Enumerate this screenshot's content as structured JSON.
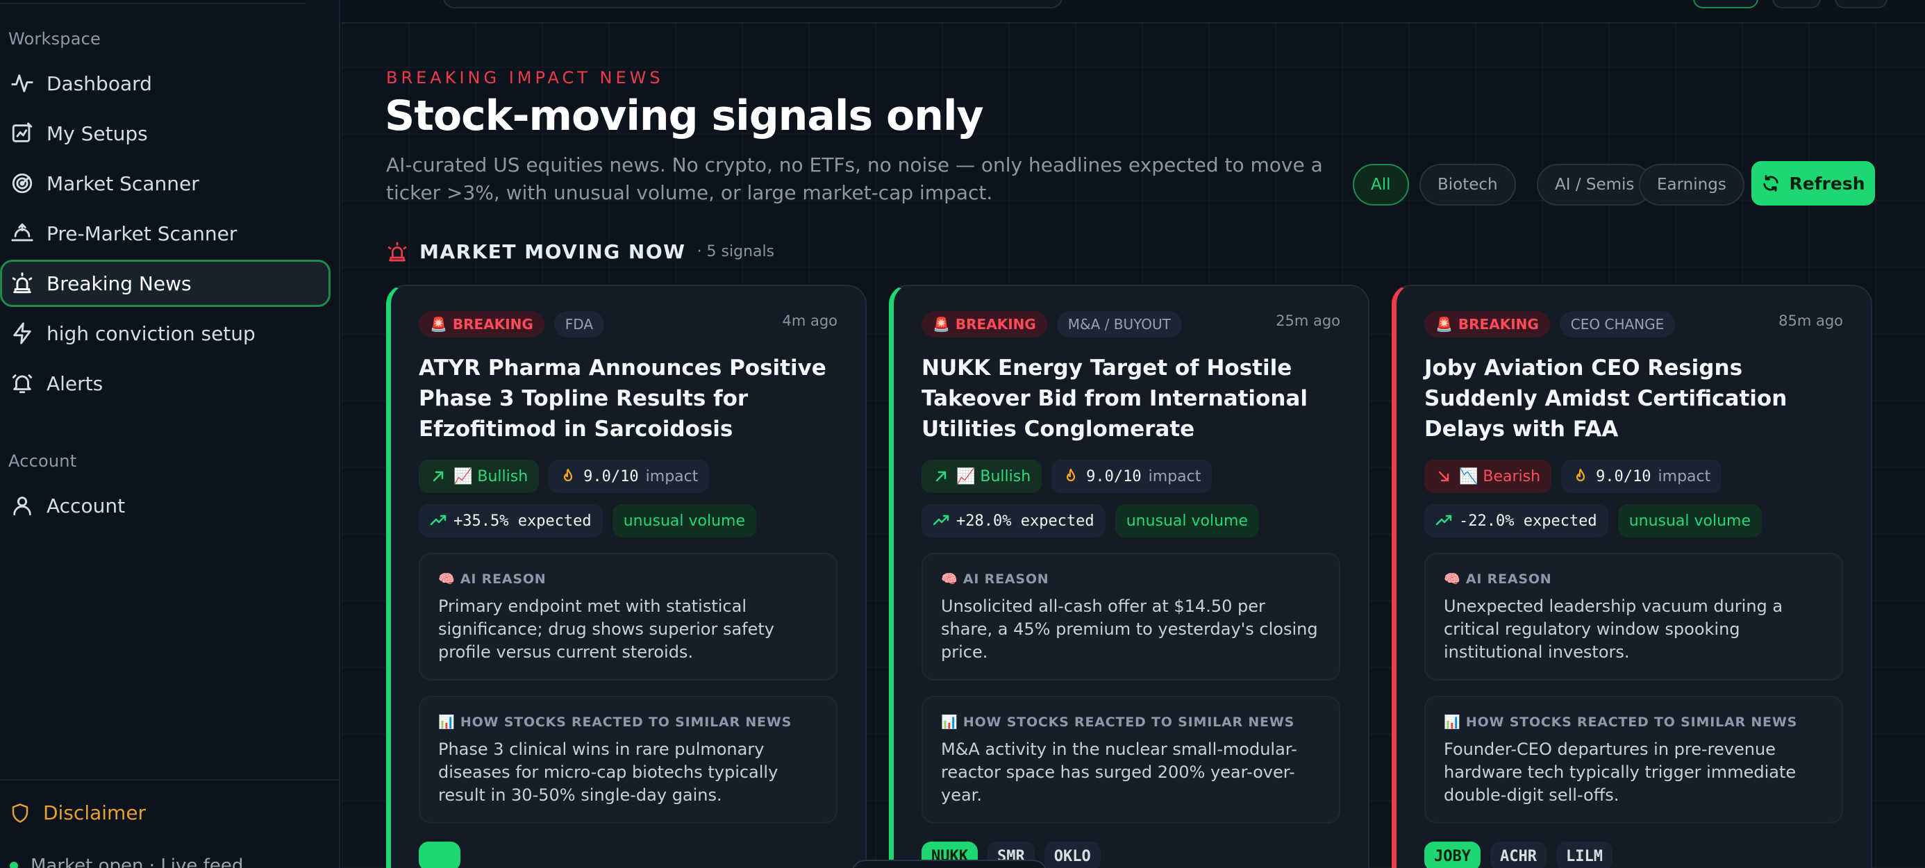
{
  "sidebar": {
    "workspace_label": "Workspace",
    "account_label": "Account",
    "items": [
      {
        "label": "Dashboard"
      },
      {
        "label": "My Setups"
      },
      {
        "label": "Market Scanner"
      },
      {
        "label": "Pre-Market Scanner"
      },
      {
        "label": "Breaking News",
        "active": true
      },
      {
        "label": "high conviction setup"
      },
      {
        "label": "Alerts"
      }
    ],
    "account_items": [
      {
        "label": "Account"
      }
    ],
    "disclaimer": "Disclaimer",
    "feed_status": "Market open · Live feed"
  },
  "header": {
    "eyebrow": "BREAKING IMPACT NEWS",
    "title": "Stock-moving signals only",
    "subtitle": "AI-curated US equities news. No crypto, no ETFs, no noise — only headlines expected to move a ticker >3%, with unusual volume, or large market-cap impact."
  },
  "filters": [
    {
      "label": "All",
      "active": true
    },
    {
      "label": "Biotech"
    },
    {
      "label": "AI / Semis"
    },
    {
      "label": "Earnings"
    }
  ],
  "refresh_label": "Refresh",
  "section": {
    "title": "MARKET MOVING NOW",
    "count": "· 5 signals"
  },
  "colors": {
    "bullish": "#1ed672",
    "bearish": "#ef3b4b",
    "breaking": "#ff4a5a",
    "accent": "#1ed672"
  },
  "cards": [
    {
      "tag": "BREAKING",
      "category": "FDA",
      "time": "4m ago",
      "headline": "ATYR Pharma Announces Positive Phase 3 Topline Results for Efzofitimod in Sarcoidosis",
      "sentiment": "📈 Bullish",
      "score": "9.0/10",
      "impact_word": "impact",
      "expected": "+35.5% expected",
      "volume": "unusual volume",
      "ai_label": "🧠 AI REASON",
      "ai_reason": "Primary endpoint met with statistical significance; drug shows superior safety profile versus current steroids.",
      "hist_label": "📊 HOW STOCKS REACTED TO SIMILAR NEWS",
      "hist_text": "Phase 3 clinical wins in rare pulmonary diseases for micro-cap biotechs typically result in 30-50% single-day gains.",
      "tickers": []
    },
    {
      "tag": "BREAKING",
      "category": "M&A / BUYOUT",
      "time": "25m ago",
      "headline": "NUKK Energy Target of Hostile Takeover Bid from International Utilities Conglomerate",
      "sentiment": "📈 Bullish",
      "score": "9.0/10",
      "impact_word": "impact",
      "expected": "+28.0% expected",
      "volume": "unusual volume",
      "ai_label": "🧠 AI REASON",
      "ai_reason": "Unsolicited all-cash offer at $14.50 per share, a 45% premium to yesterday's closing price.",
      "hist_label": "📊 HOW STOCKS REACTED TO SIMILAR NEWS",
      "hist_text": "M&A activity in the nuclear small-modular-reactor space has surged 200% year-over-year.",
      "tickers": [
        "NUKK",
        "SMR",
        "OKLO"
      ]
    },
    {
      "tag": "BREAKING",
      "category": "CEO CHANGE",
      "time": "85m ago",
      "headline": "Joby Aviation CEO Resigns Suddenly Amidst Certification Delays with FAA",
      "sentiment": "📉 Bearish",
      "score": "9.0/10",
      "impact_word": "impact",
      "expected": "-22.0% expected",
      "volume": "unusual volume",
      "ai_label": "🧠 AI REASON",
      "ai_reason": "Unexpected leadership vacuum during a critical regulatory window spooking institutional investors.",
      "hist_label": "📊 HOW STOCKS REACTED TO SIMILAR NEWS",
      "hist_text": "Founder-CEO departures in pre-revenue hardware tech typically trigger immediate double-digit sell-offs.",
      "tickers": [
        "JOBY",
        "ACHR",
        "LILM"
      ]
    }
  ]
}
